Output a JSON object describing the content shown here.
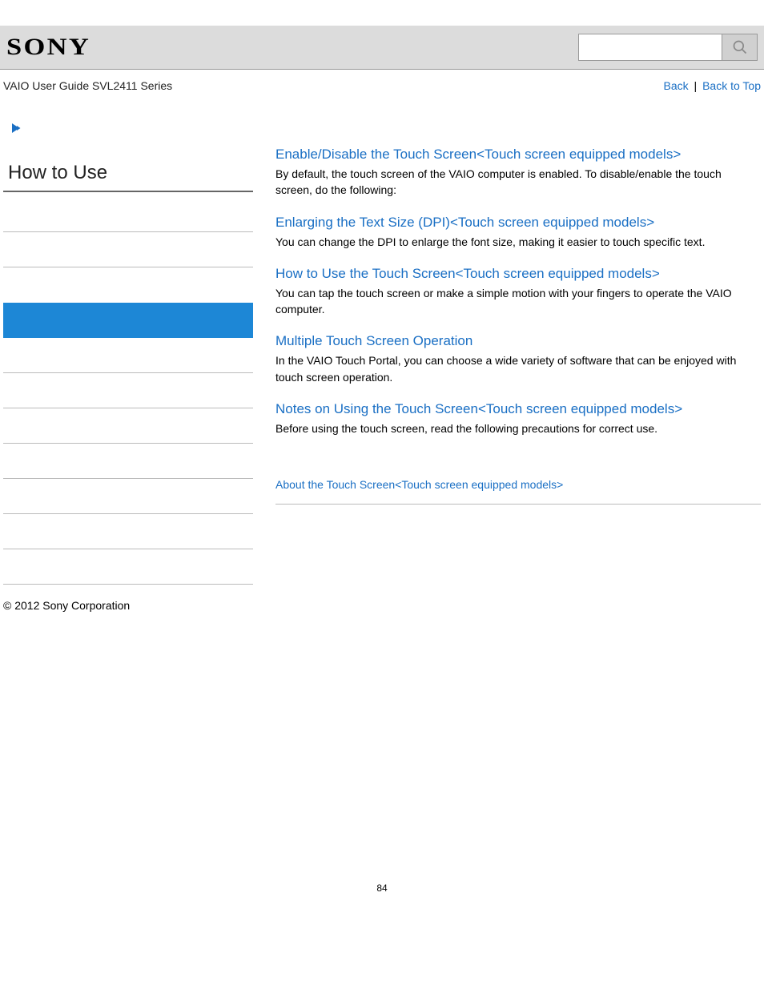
{
  "logo": "SONY",
  "search": {
    "placeholder": ""
  },
  "guide_title": "VAIO User Guide SVL2411 Series",
  "nav": {
    "back": "Back",
    "sep": " | ",
    "top": "Back to Top"
  },
  "sidebar": {
    "title": "How to Use",
    "items": [
      {
        "active": false
      },
      {
        "active": false
      },
      {
        "active": false
      },
      {
        "active": true
      },
      {
        "active": false
      },
      {
        "active": false
      },
      {
        "active": false
      },
      {
        "active": false
      },
      {
        "active": false
      },
      {
        "active": false
      },
      {
        "active": false
      }
    ]
  },
  "topics": [
    {
      "title": "Enable/Disable the Touch Screen<Touch screen equipped models>",
      "desc": "By default, the touch screen of the VAIO computer is enabled. To disable/enable the touch screen, do the following:"
    },
    {
      "title": "Enlarging the Text Size (DPI)<Touch screen equipped models>",
      "desc": "You can change the DPI to enlarge the font size, making it easier to touch specific text."
    },
    {
      "title": "How to Use the Touch Screen<Touch screen equipped models>",
      "desc": "You can tap the touch screen or make a simple motion with your fingers to operate the VAIO computer."
    },
    {
      "title": "Multiple Touch Screen Operation",
      "desc": "In the VAIO Touch Portal, you can choose a wide variety of software that can be enjoyed with touch screen operation."
    },
    {
      "title": "Notes on Using the Touch Screen<Touch screen equipped models>",
      "desc": "Before using the touch screen, read the following precautions for correct use."
    }
  ],
  "related": {
    "link": "About the Touch Screen<Touch screen equipped models>"
  },
  "footer": "© 2012 Sony Corporation",
  "page_number": "84"
}
